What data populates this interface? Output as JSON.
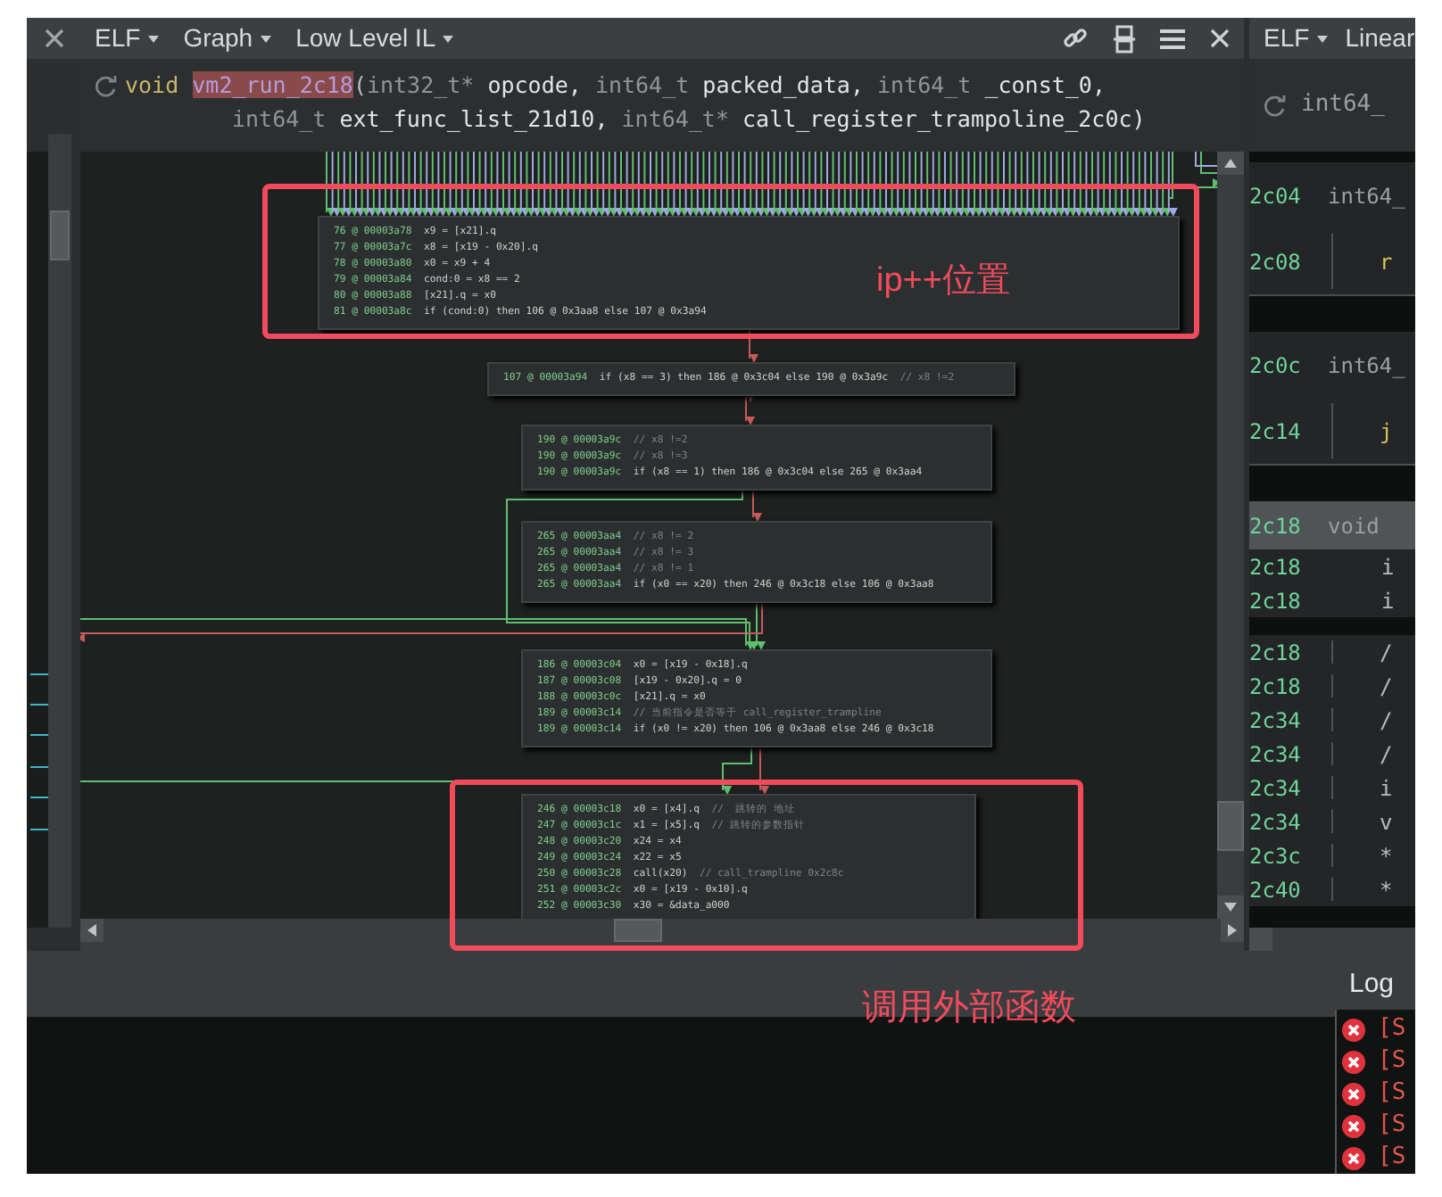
{
  "graph_view": {
    "menus": [
      {
        "label": "ELF"
      },
      {
        "label": "Graph"
      },
      {
        "label": "Low Level IL"
      }
    ],
    "signature": {
      "lines": [
        [
          {
            "kind": "keyword",
            "text": "void"
          },
          {
            "kind": "name",
            "text": "vm2_run_2c18"
          },
          {
            "kind": "punct",
            "text": "("
          },
          {
            "kind": "type",
            "text": "int32_t*"
          },
          {
            "kind": "ident",
            "text": "opcode,"
          },
          {
            "kind": "type",
            "text": "int64_t"
          },
          {
            "kind": "ident",
            "text": "packed_data,"
          },
          {
            "kind": "type",
            "text": "int64_t"
          },
          {
            "kind": "ident",
            "text": "_const_0,"
          }
        ],
        [
          {
            "kind": "type",
            "text": "int64_t"
          },
          {
            "kind": "ident",
            "text": "ext_func_list_21d10,"
          },
          {
            "kind": "type",
            "text": "int64_t*"
          },
          {
            "kind": "ident",
            "text": "call_register_trampoline_2c0c)"
          }
        ]
      ]
    },
    "nodes": [
      {
        "lines": [
          {
            "location": "76 @ 00003a78",
            "code": "x9 = [x21].q"
          },
          {
            "location": "77 @ 00003a7c",
            "code": "x8 = [x19 - 0x20].q"
          },
          {
            "location": "78 @ 00003a80",
            "code": "x0 = x9 + 4"
          },
          {
            "location": "79 @ 00003a84",
            "code": "cond:0 = x8 == 2"
          },
          {
            "location": "80 @ 00003a88",
            "code": "[x21].q = x0"
          },
          {
            "location": "81 @ 00003a8c",
            "code": "if (cond:0) then 106 @ 0x3aa8 else 107 @ 0x3a94"
          }
        ]
      },
      {
        "lines": [
          {
            "location": "107 @ 00003a94",
            "code": "if (x8 == 3) then 186 @ 0x3c04 else 190 @ 0x3a9c",
            "comment": "// x8 !=2"
          }
        ]
      },
      {
        "lines": [
          {
            "location": "190 @ 00003a9c",
            "comment": "// x8 !=2"
          },
          {
            "location": "190 @ 00003a9c",
            "comment": "// x8 !=3"
          },
          {
            "location": "190 @ 00003a9c",
            "code": "if (x8 == 1) then 186 @ 0x3c04 else 265 @ 0x3aa4"
          }
        ]
      },
      {
        "lines": [
          {
            "location": "265 @ 00003aa4",
            "comment": "// x8 != 2"
          },
          {
            "location": "265 @ 00003aa4",
            "comment": "// x8 != 3"
          },
          {
            "location": "265 @ 00003aa4",
            "comment": "// x8 != 1"
          },
          {
            "location": "265 @ 00003aa4",
            "code": "if (x0 == x20) then 246 @ 0x3c18 else 106 @ 0x3aa8"
          }
        ]
      },
      {
        "lines": [
          {
            "location": "186 @ 00003c04",
            "code": "x0 = [x19 - 0x18].q"
          },
          {
            "location": "187 @ 00003c08",
            "code": "[x19 - 0x20].q = 0"
          },
          {
            "location": "188 @ 00003c0c",
            "code": "[x21].q = x0"
          },
          {
            "location": "189 @ 00003c14",
            "comment": "// 当前指令是否等于 call_register_trampline"
          },
          {
            "location": "189 @ 00003c14",
            "code": "if (x0 != x20) then 106 @ 0x3aa8 else 246 @ 0x3c18"
          }
        ]
      },
      {
        "lines": [
          {
            "location": "246 @ 00003c18",
            "code": "x0 = [x4].q",
            "comment": "//  跳转的 地址"
          },
          {
            "location": "247 @ 00003c1c",
            "code": "x1 = [x5].q",
            "comment": "// 跳转的参数指针"
          },
          {
            "location": "248 @ 00003c20",
            "code": "x24 = x4"
          },
          {
            "location": "249 @ 00003c24",
            "code": "x22 = x5"
          },
          {
            "location": "250 @ 00003c28",
            "code": "call(x20)",
            "comment": "// call_trampline 0x2c8c"
          },
          {
            "location": "251 @ 00003c2c",
            "code": "x0 = [x19 - 0x10].q"
          },
          {
            "location": "252 @ 00003c30",
            "code": "x30 = &data_a000"
          }
        ]
      }
    ]
  },
  "linear_view": {
    "menus": [
      {
        "label": "ELF"
      },
      {
        "label": "Linear"
      }
    ],
    "signature": "int64_",
    "rows": [
      {
        "kind": "header",
        "address": "2c04",
        "text": "int64_"
      },
      {
        "kind": "call",
        "address": "2c08",
        "text": "r"
      },
      {
        "kind": "gap"
      },
      {
        "kind": "header",
        "address": "2c0c",
        "text": "int64_"
      },
      {
        "kind": "call",
        "address": "2c14",
        "text": "j"
      },
      {
        "kind": "gap"
      },
      {
        "kind": "current",
        "address": "2c18",
        "text": "void"
      },
      {
        "kind": "param",
        "address": "2c18",
        "text": "i"
      },
      {
        "kind": "param",
        "address": "2c18",
        "text": "i"
      },
      {
        "kind": "code",
        "address": "2c18",
        "text": "/"
      },
      {
        "kind": "code",
        "address": "2c18",
        "text": "/"
      },
      {
        "kind": "code",
        "address": "2c34",
        "text": "/"
      },
      {
        "kind": "code",
        "address": "2c34",
        "text": "/"
      },
      {
        "kind": "code",
        "address": "2c34",
        "text": "i"
      },
      {
        "kind": "code",
        "address": "2c34",
        "text": "v"
      },
      {
        "kind": "code",
        "address": "2c3c",
        "text": "*"
      },
      {
        "kind": "code",
        "address": "2c40",
        "text": "*"
      }
    ]
  },
  "log": {
    "title": "Log",
    "entries": [
      {
        "text": "[S"
      },
      {
        "text": "[S"
      },
      {
        "text": "[S"
      },
      {
        "text": "[S"
      },
      {
        "text": "[S"
      }
    ]
  },
  "annotations": [
    {
      "text": "ip++位置"
    },
    {
      "text": "调用外部函数"
    }
  ]
}
